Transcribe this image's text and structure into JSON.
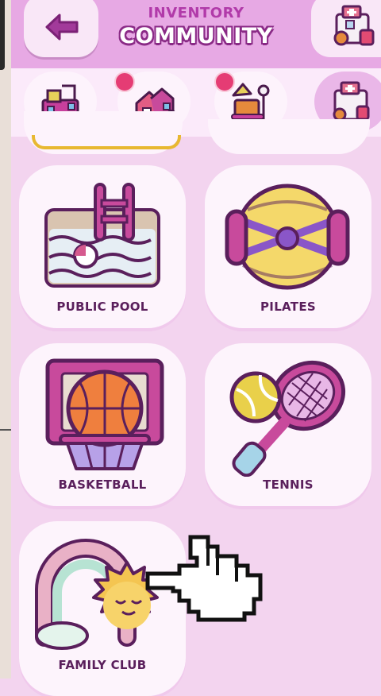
{
  "header": {
    "section_label": "INVENTORY",
    "title": "COMMUNITY",
    "back_icon": "arrow-left-icon"
  },
  "tabs": [
    {
      "name": "construction",
      "active": false,
      "notification": false
    },
    {
      "name": "houses",
      "active": false,
      "notification": true
    },
    {
      "name": "hobbies",
      "active": false,
      "notification": true
    },
    {
      "name": "community",
      "active": true,
      "notification": false
    }
  ],
  "items": [
    {
      "label": "PUBLIC POOL"
    },
    {
      "label": "PILATES"
    },
    {
      "label": "BASKETBALL"
    },
    {
      "label": "TENNIS"
    },
    {
      "label": "FAMILY CLUB"
    }
  ],
  "colors": {
    "header": "#e7a9e4",
    "accent": "#b13aa9",
    "background": "#f3d4ef",
    "notification": "#e53c74"
  }
}
